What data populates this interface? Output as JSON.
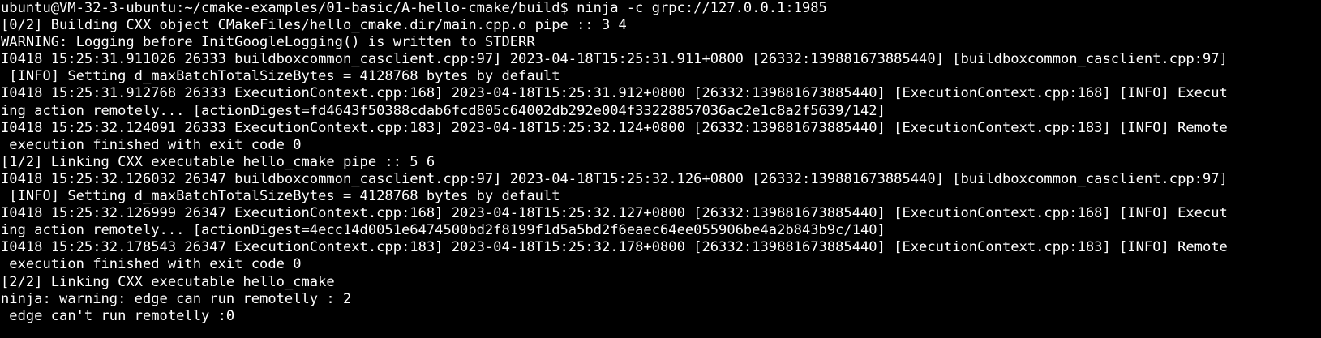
{
  "terminal": {
    "lines": [
      "ubuntu@VM-32-3-ubuntu:~/cmake-examples/01-basic/A-hello-cmake/build$ ninja -c grpc://127.0.0.1:1985",
      "[0/2] Building CXX object CMakeFiles/hello_cmake.dir/main.cpp.o pipe :: 3 4",
      "WARNING: Logging before InitGoogleLogging() is written to STDERR",
      "I0418 15:25:31.911026 26333 buildboxcommon_casclient.cpp:97] 2023-04-18T15:25:31.911+0800 [26332:139881673885440] [buildboxcommon_casclient.cpp:97]",
      " [INFO] Setting d_maxBatchTotalSizeBytes = 4128768 bytes by default",
      "I0418 15:25:31.912768 26333 ExecutionContext.cpp:168] 2023-04-18T15:25:31.912+0800 [26332:139881673885440] [ExecutionContext.cpp:168] [INFO] Execut",
      "ing action remotely... [actionDigest=fd4643f50388cdab6fcd805c64002db292e004f33228857036ac2e1c8a2f5639/142]",
      "I0418 15:25:32.124091 26333 ExecutionContext.cpp:183] 2023-04-18T15:25:32.124+0800 [26332:139881673885440] [ExecutionContext.cpp:183] [INFO] Remote",
      " execution finished with exit code 0",
      "[1/2] Linking CXX executable hello_cmake pipe :: 5 6",
      "I0418 15:25:32.126032 26347 buildboxcommon_casclient.cpp:97] 2023-04-18T15:25:32.126+0800 [26332:139881673885440] [buildboxcommon_casclient.cpp:97]",
      " [INFO] Setting d_maxBatchTotalSizeBytes = 4128768 bytes by default",
      "I0418 15:25:32.126999 26347 ExecutionContext.cpp:168] 2023-04-18T15:25:32.127+0800 [26332:139881673885440] [ExecutionContext.cpp:168] [INFO] Execut",
      "ing action remotely... [actionDigest=4ecc14d0051e6474500bd2f8199f1d5a5bd2f6eaec64ee055906be4a2b843b9c/140]",
      "I0418 15:25:32.178543 26347 ExecutionContext.cpp:183] 2023-04-18T15:25:32.178+0800 [26332:139881673885440] [ExecutionContext.cpp:183] [INFO] Remote",
      " execution finished with exit code 0",
      "[2/2] Linking CXX executable hello_cmake",
      "ninja: warning: edge can run remotelly : 2",
      " edge can't run remotelly :0"
    ]
  },
  "colors": {
    "background": "#000000",
    "foreground": "#ffffff"
  }
}
